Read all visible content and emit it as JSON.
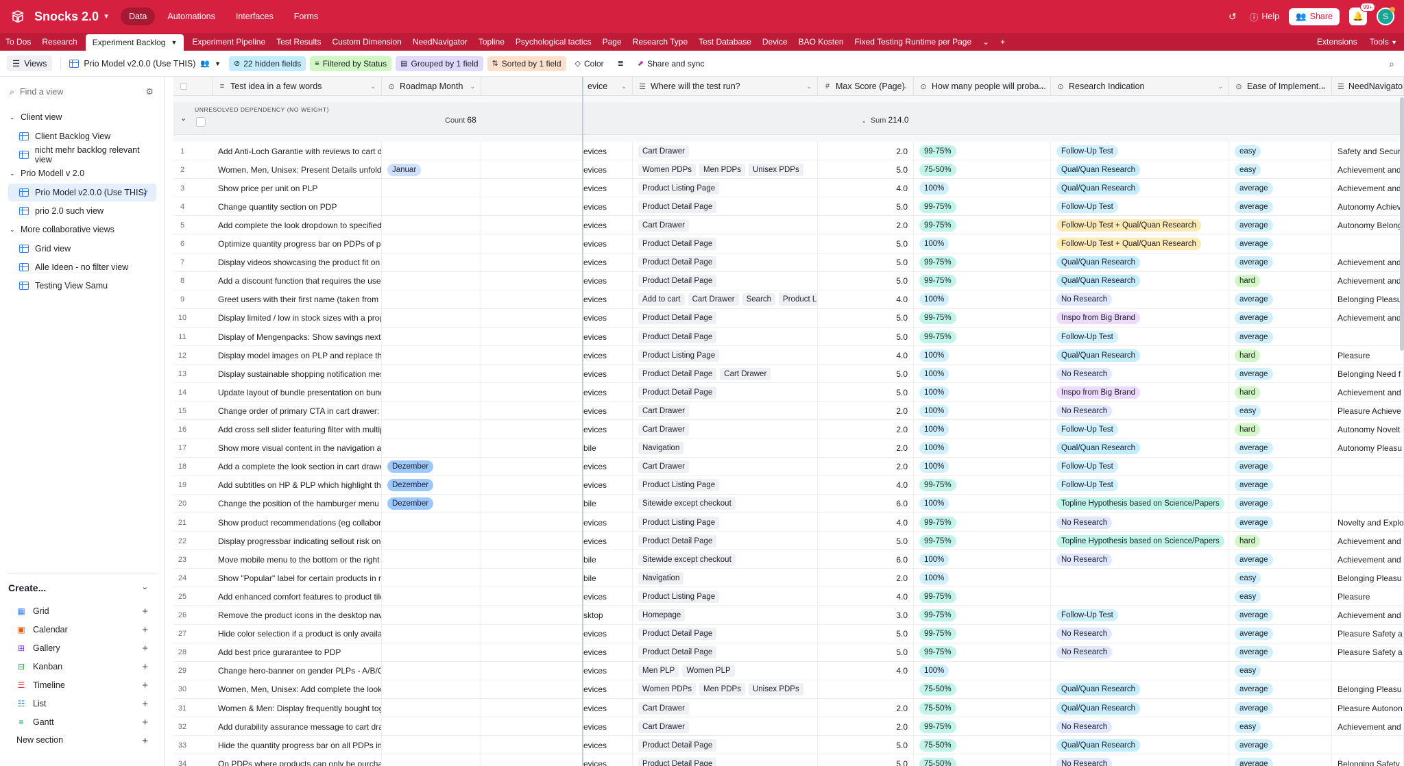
{
  "app": {
    "base_name": "Snocks 2.0",
    "nav": [
      "Data",
      "Automations",
      "Interfaces",
      "Forms"
    ],
    "help_label": "Help",
    "share_label": "Share",
    "notif_count": "99+",
    "avatar_initial": "S"
  },
  "tabs": [
    "To Dos",
    "Research",
    "Experiment Backlog",
    "Experiment Pipeline",
    "Test Results",
    "Custom Dimension",
    "NeedNavigator",
    "Topline",
    "Psychological tactics",
    "Page",
    "Research Type",
    "Test Database",
    "Device",
    "BAO Kosten",
    "Fixed Testing Runtime per Page"
  ],
  "tabs_right": [
    "Extensions",
    "Tools"
  ],
  "viewbar": {
    "views_label": "Views",
    "view_name": "Prio Model v2.0.0 (Use THIS)",
    "hidden_fields": "22 hidden fields",
    "filtered": "Filtered by Status",
    "grouped": "Grouped by 1 field",
    "sorted": "Sorted by 1 field",
    "color": "Color",
    "share_sync": "Share and sync"
  },
  "sidebar": {
    "find_placeholder": "Find a view",
    "sections": [
      {
        "title": "Client view",
        "items": [
          "Client Backlog View",
          "nicht mehr backlog relevant view"
        ]
      },
      {
        "title": "Prio Modell v 2.0",
        "items": [
          "Prio Model v2.0.0 (Use THIS)",
          "prio 2.0 such view"
        ]
      },
      {
        "title": "More collaborative views",
        "items": [
          "Grid view",
          "Alle Ideen - no filter view",
          "Testing View Samu"
        ]
      }
    ],
    "create_label": "Create...",
    "create_items": [
      "Grid",
      "Calendar",
      "Gallery",
      "Kanban",
      "Timeline",
      "List",
      "Gantt"
    ],
    "new_section": "New section"
  },
  "grid": {
    "columns": [
      "Test idea in a few words",
      "Roadmap Month",
      "evice",
      "Where will the test run?",
      "Max Score (Page)",
      "How many people will proba...",
      "Research Indication",
      "Ease of Implement...",
      "NeedNavigator"
    ],
    "group_label": "UNRESOLVED DEPENDENCY (NO WEIGHT)",
    "count_label": "Count",
    "count_value": "68",
    "sum_label": "Sum",
    "sum_value": "214.0",
    "colors": {
      "Januar": "#cfdfff",
      "Dezember": "#9cc7ff",
      "99-75%": "#c2f5e9",
      "75-50%": "#c2f5e9",
      "100%": "#d0f0fd",
      "Follow-Up Test": "#d0f0fd",
      "Qual/Quan Research": "#c4ecff",
      "Follow-Up Test + Qual/Quan Research": "#ffeab6",
      "No Research": "#e0e7ff",
      "Inspo from Big Brand": "#eddbff",
      "Topline Hypothesis based on Science/Papers": "#c2f5e9",
      "easy": "#d0f0fd",
      "average": "#d0f0fd",
      "hard": "#d1f7c4"
    },
    "rows": [
      {
        "n": "1",
        "idea": "Add Anti-Loch Garantie with reviews to cart drawer",
        "month": "",
        "device": "evices",
        "where": [
          "Cart Drawer"
        ],
        "score": "2.0",
        "people": "99-75%",
        "research": "Follow-Up Test",
        "ease": "easy",
        "need": "Safety and Security"
      },
      {
        "n": "2",
        "idea": "Women, Men, Unisex: Present Details unfolded per default on PDPs - La...",
        "month": "Januar",
        "device": "evices",
        "where": [
          "Women PDPs",
          "Men PDPs",
          "Unisex PDPs"
        ],
        "score": "5.0",
        "people": "75-50%",
        "research": "Qual/Quan Research",
        "ease": "easy",
        "need": "Achievement and C"
      },
      {
        "n": "3",
        "idea": "Show price per unit on PLP",
        "month": "",
        "device": "evices",
        "where": [
          "Product Listing Page"
        ],
        "score": "4.0",
        "people": "100%",
        "research": "Qual/Quan Research",
        "ease": "average",
        "need": "Achievement and C"
      },
      {
        "n": "4",
        "idea": "Change quantity section on PDP",
        "month": "",
        "device": "evices",
        "where": [
          "Product Detail Page"
        ],
        "score": "5.0",
        "people": "99-75%",
        "research": "Follow-Up Test",
        "ease": "average",
        "need": "Autonomy  Achiev"
      },
      {
        "n": "5",
        "idea": "Add complete the look dropdown to specified products in cart drawer",
        "month": "",
        "device": "evices",
        "where": [
          "Cart Drawer"
        ],
        "score": "2.0",
        "people": "99-75%",
        "research": "Follow-Up Test + Qual/Quan Research",
        "ease": "average",
        "need": "Autonomy  Belong"
      },
      {
        "n": "6",
        "idea": "Optimize quantity progress bar on PDPs of products in the categories \"...",
        "month": "",
        "device": "evices",
        "where": [
          "Product Detail Page"
        ],
        "score": "5.0",
        "people": "100%",
        "research": "Follow-Up Test + Qual/Quan Research",
        "ease": "average",
        "need": ""
      },
      {
        "n": "7",
        "idea": "Display videos showcasing the product fit on selected PDPs",
        "month": "",
        "device": "evices",
        "where": [
          "Product Detail Page"
        ],
        "score": "5.0",
        "people": "99-75%",
        "research": "Qual/Quan Research",
        "ease": "average",
        "need": "Achievement and C"
      },
      {
        "n": "8",
        "idea": "Add a discount function that requires the user to take action themselves...",
        "month": "",
        "device": "evices",
        "where": [
          "Product Detail Page"
        ],
        "score": "5.0",
        "people": "99-75%",
        "research": "Qual/Quan Research",
        "ease": "hard",
        "need": "Achievement and C"
      },
      {
        "n": "9",
        "idea": "Greet users with their first name (taken from klaviyo) upon visiting the o...",
        "month": "",
        "device": "evices",
        "where": [
          "Add to cart",
          "Cart Drawer",
          "Search",
          "Product Listing"
        ],
        "score": "4.0",
        "people": "100%",
        "research": "No Research",
        "ease": "average",
        "need": "Belonging  Pleasu"
      },
      {
        "n": "10",
        "idea": "Display limited / low in stock sizes with a progressbar below the size on ...",
        "month": "",
        "device": "evices",
        "where": [
          "Product Detail Page"
        ],
        "score": "5.0",
        "people": "99-75%",
        "research": "Inspo from Big Brand",
        "ease": "average",
        "need": "Achievement and C"
      },
      {
        "n": "11",
        "idea": "Display of Mengenpacks: Show savings next to ATC, move qty selecttion...",
        "month": "",
        "device": "evices",
        "where": [
          "Product Detail Page"
        ],
        "score": "5.0",
        "people": "99-75%",
        "research": "Follow-Up Test",
        "ease": "average",
        "need": ""
      },
      {
        "n": "12",
        "idea": "Display model images on PLP and replace the existing ones on correspo...",
        "month": "",
        "device": "evices",
        "where": [
          "Product Listing Page"
        ],
        "score": "4.0",
        "people": "100%",
        "research": "Qual/Quan Research",
        "ease": "hard",
        "need": "Pleasure"
      },
      {
        "n": "13",
        "idea": "Display sustainable shopping notification message if user adds two diffe...",
        "month": "",
        "device": "evices",
        "where": [
          "Product Detail Page",
          "Cart Drawer"
        ],
        "score": "5.0",
        "people": "100%",
        "research": "No Research",
        "ease": "average",
        "need": "Belonging  Need f"
      },
      {
        "n": "14",
        "idea": "Update layout of bundle presentation on bundle PDPs: Display Bundles ...",
        "month": "",
        "device": "evices",
        "where": [
          "Product Detail Page"
        ],
        "score": "5.0",
        "people": "100%",
        "research": "Inspo from Big Brand",
        "ease": "hard",
        "need": "Achievement and C"
      },
      {
        "n": "15",
        "idea": "Change order of primary CTA in cart drawer: move it to top of cart drawer",
        "month": "",
        "device": "evices",
        "where": [
          "Cart Drawer"
        ],
        "score": "2.0",
        "people": "100%",
        "research": "No Research",
        "ease": "easy",
        "need": "Pleasure  Achieve"
      },
      {
        "n": "16",
        "idea": "Add cross sell slider featuring filter with multiple product categories to c...",
        "month": "",
        "device": "evices",
        "where": [
          "Cart Drawer"
        ],
        "score": "2.0",
        "people": "100%",
        "research": "Follow-Up Test",
        "ease": "hard",
        "need": "Autonomy  Novelt"
      },
      {
        "n": "17",
        "idea": "Show more visual content in the navigation and personalize navigation w...",
        "month": "",
        "device": "bile",
        "where": [
          "Navigation"
        ],
        "score": "2.0",
        "people": "100%",
        "research": "Qual/Quan Research",
        "ease": "average",
        "need": "Autonomy  Pleasu"
      },
      {
        "n": "18",
        "idea": "Add a complete the look section in cart drawer for selected products",
        "month": "Dezember",
        "device": "evices",
        "where": [
          "Cart Drawer"
        ],
        "score": "2.0",
        "people": "100%",
        "research": "Follow-Up Test",
        "ease": "average",
        "need": ""
      },
      {
        "n": "19",
        "idea": "Add subtitles on HP & PLP which highlight the material",
        "month": "Dezember",
        "device": "evices",
        "where": [
          "Product Listing Page"
        ],
        "score": "4.0",
        "people": "99-75%",
        "research": "Follow-Up Test",
        "ease": "average",
        "need": ""
      },
      {
        "n": "20",
        "idea": "Change the position of the hamburger menu in the header - sitewide mo...",
        "month": "Dezember",
        "device": "bile",
        "where": [
          "Sitewide except checkout"
        ],
        "score": "6.0",
        "people": "100%",
        "research": "Topline Hypothesis based on Science/Papers",
        "ease": "average",
        "need": ""
      },
      {
        "n": "21",
        "idea": "Show product recommendations (eg collaboration products) at the begi...",
        "month": "",
        "device": "evices",
        "where": [
          "Product Listing Page"
        ],
        "score": "4.0",
        "people": "99-75%",
        "research": "No Research",
        "ease": "average",
        "need": "Novelty and Explor"
      },
      {
        "n": "22",
        "idea": "Display progressbar indicating sellout risk on PDP",
        "month": "",
        "device": "evices",
        "where": [
          "Product Detail Page"
        ],
        "score": "5.0",
        "people": "99-75%",
        "research": "Topline Hypothesis based on Science/Papers",
        "ease": "hard",
        "need": "Achievement and C"
      },
      {
        "n": "23",
        "idea": "Move mobile menu to the bottom or the right side",
        "month": "",
        "device": "bile",
        "where": [
          "Sitewide except checkout"
        ],
        "score": "6.0",
        "people": "100%",
        "research": "No Research",
        "ease": "average",
        "need": "Achievement and C"
      },
      {
        "n": "24",
        "idea": "Show \"Popular\" label for certain products in mobile navigation",
        "month": "",
        "device": "bile",
        "where": [
          "Navigation"
        ],
        "score": "2.0",
        "people": "100%",
        "research": "",
        "ease": "easy",
        "need": "Belonging  Pleasu"
      },
      {
        "n": "25",
        "idea": "Add enhanced comfort features to product tiles on PLP",
        "month": "",
        "device": "evices",
        "where": [
          "Product Listing Page"
        ],
        "score": "4.0",
        "people": "99-75%",
        "research": "",
        "ease": "easy",
        "need": "Pleasure"
      },
      {
        "n": "26",
        "idea": "Remove the product icons in the desktop navigation - Desktop only",
        "month": "",
        "device": "sktop",
        "where": [
          "Homepage"
        ],
        "score": "3.0",
        "people": "99-75%",
        "research": "Follow-Up Test",
        "ease": "average",
        "need": "Achievement and C"
      },
      {
        "n": "27",
        "idea": "Hide color selection if a product is only available in one color - PDP",
        "month": "",
        "device": "evices",
        "where": [
          "Product Detail Page"
        ],
        "score": "5.0",
        "people": "99-75%",
        "research": "No Research",
        "ease": "average",
        "need": "Pleasure  Safety a"
      },
      {
        "n": "28",
        "idea": "Add best price gurarantee to PDP",
        "month": "",
        "device": "evices",
        "where": [
          "Product Detail Page"
        ],
        "score": "5.0",
        "people": "99-75%",
        "research": "No Research",
        "ease": "average",
        "need": "Pleasure  Safety a"
      },
      {
        "n": "29",
        "idea": "Change hero-banner on gender PLPs - A/B/C test",
        "month": "",
        "device": "evices",
        "where": [
          "Men PLP",
          "Women PLP"
        ],
        "score": "4.0",
        "people": "100%",
        "research": "",
        "ease": "easy",
        "need": ""
      },
      {
        "n": "30",
        "idea": "Women, Men, Unisex: Add complete the look section in image slider on ...",
        "month": "",
        "device": "evices",
        "where": [
          "Women PDPs",
          "Men PDPs",
          "Unisex PDPs"
        ],
        "score": "",
        "people": "75-50%",
        "research": "Qual/Quan Research",
        "ease": "average",
        "need": "Belonging  Pleasu"
      },
      {
        "n": "31",
        "idea": "Women & Men: Display frequently bought together section in cart",
        "month": "",
        "device": "evices",
        "where": [
          "Cart Drawer"
        ],
        "score": "2.0",
        "people": "75-50%",
        "research": "Qual/Quan Research",
        "ease": "average",
        "need": "Pleasure  Autonon"
      },
      {
        "n": "32",
        "idea": "Add durability assurance message to cart drawer",
        "month": "",
        "device": "evices",
        "where": [
          "Cart Drawer"
        ],
        "score": "2.0",
        "people": "99-75%",
        "research": "No Research",
        "ease": "easy",
        "need": "Achievement and C"
      },
      {
        "n": "33",
        "idea": "Hide the quantity progress bar on all PDPs in the category \"Bekleidung\"",
        "month": "",
        "device": "evices",
        "where": [
          "Product Detail Page"
        ],
        "score": "5.0",
        "people": "75-50%",
        "research": "Qual/Quan Research",
        "ease": "average",
        "need": ""
      },
      {
        "n": "34",
        "idea": "On PDPs where products can only be purchased via a pre-order, display ...",
        "month": "",
        "device": "evices",
        "where": [
          "Product Detail Page"
        ],
        "score": "5.0",
        "people": "75-50%",
        "research": "No Research",
        "ease": "average",
        "need": "Belonging  Safety"
      }
    ]
  }
}
